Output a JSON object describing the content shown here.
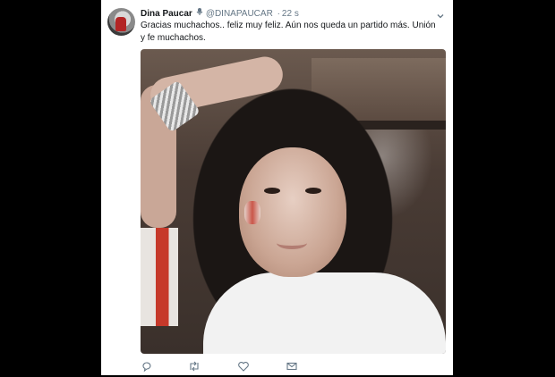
{
  "tweet": {
    "display_name": "Dina Paucar",
    "handle": "@DINAPAUCAR",
    "separator": "·",
    "timestamp": "22 s",
    "text": "Gracias muchachos.. feliz muy feliz. Aún nos queda un partido más. Unión y fe muchachos."
  },
  "icons": {
    "badge": "microphone-emoji-icon",
    "menu": "chevron-down-icon",
    "reply": "reply-icon",
    "retweet": "retweet-icon",
    "like": "heart-icon",
    "dm": "envelope-icon"
  },
  "colors": {
    "text": "#14171a",
    "muted": "#657786",
    "link": "#1da1f2",
    "backdrop": "#000000"
  }
}
